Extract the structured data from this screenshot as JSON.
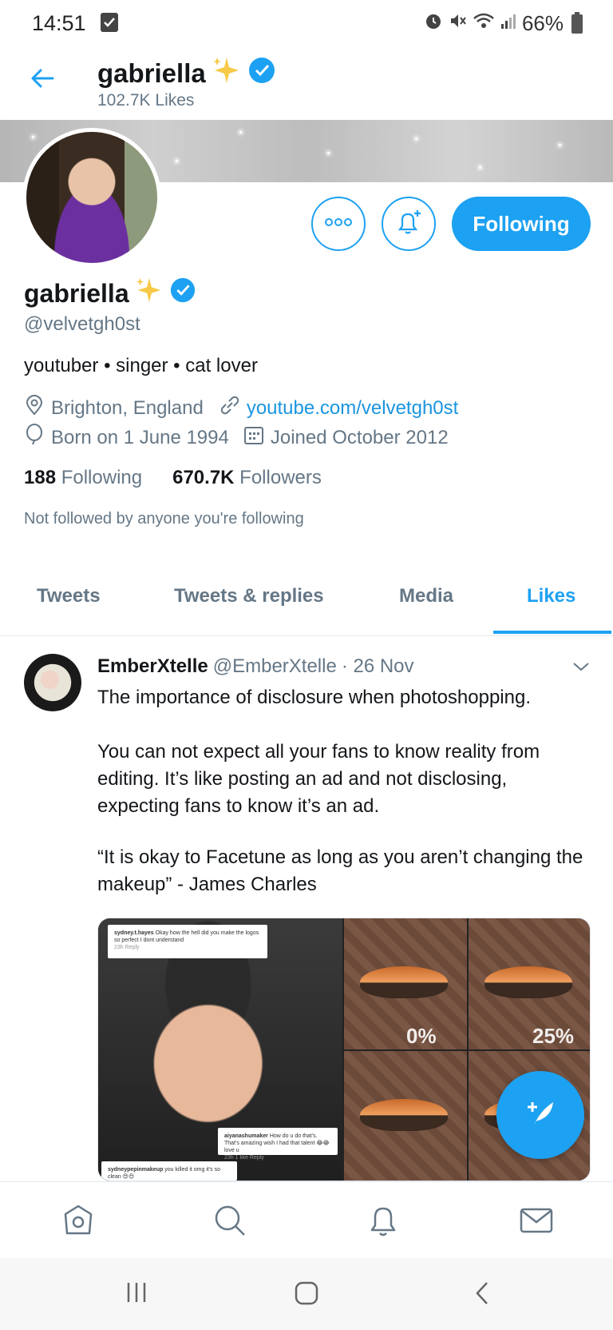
{
  "status_bar": {
    "time": "14:51",
    "battery": "66%"
  },
  "header": {
    "name": "gabriella",
    "likes": "102.7K Likes"
  },
  "profile": {
    "name": "gabriella",
    "handle": "@velvetgh0st",
    "bio": "youtuber • singer • cat lover",
    "location": "Brighton, England",
    "website": "youtube.com/velvetgh0st",
    "born": "Born on 1 June 1994",
    "joined": "Joined October 2012",
    "following_count": "188",
    "following_label": "Following",
    "followers_count": "670.7K",
    "followers_label": "Followers",
    "not_followed": "Not followed by anyone you're following",
    "following_button": "Following"
  },
  "tabs": [
    "Tweets",
    "Tweets & replies",
    "Media",
    "Likes"
  ],
  "active_tab": "Likes",
  "tweet": {
    "author": "EmberXtelle",
    "handle": "@EmberXtelle",
    "date": "· 26 Nov",
    "text_1": "The importance of disclosure when photoshopping.",
    "text_2": "You can not expect all your fans to know reality from editing. It’s like posting an ad and not disclosing, expecting fans to know it’s an ad.",
    "text_3": "“It is okay to Facetune as long as you aren’t changing the makeup” - James Charles",
    "media": {
      "comment_1_user": "sydney.t.hayes",
      "comment_1_text": "Okay how the hell did you make the logos so perfect I dont understand",
      "comment_1_meta": "23h   Reply",
      "comment_2_user": "aiyanashumaker",
      "comment_2_text": "How do u do that's. That's amazing wish I had that talent 😂😂 love u",
      "comment_2_meta": "23h   1 like   Reply",
      "comment_3_user": "sydneypepinmakeup",
      "comment_3_text": "you killed it omg it's so clean 😍😍",
      "label_1": "0%",
      "label_2": "25%"
    }
  },
  "colors": {
    "accent": "#1da1f2",
    "text": "#14171a",
    "muted": "#657786"
  },
  "icons": [
    "back-arrow-icon",
    "sparkles-icon",
    "verified-badge-icon",
    "more-icon",
    "bell-plus-icon",
    "location-icon",
    "link-icon",
    "balloon-icon",
    "calendar-icon",
    "chevron-down-icon",
    "compose-icon",
    "home-icon",
    "search-icon",
    "bell-icon",
    "mail-icon"
  ]
}
